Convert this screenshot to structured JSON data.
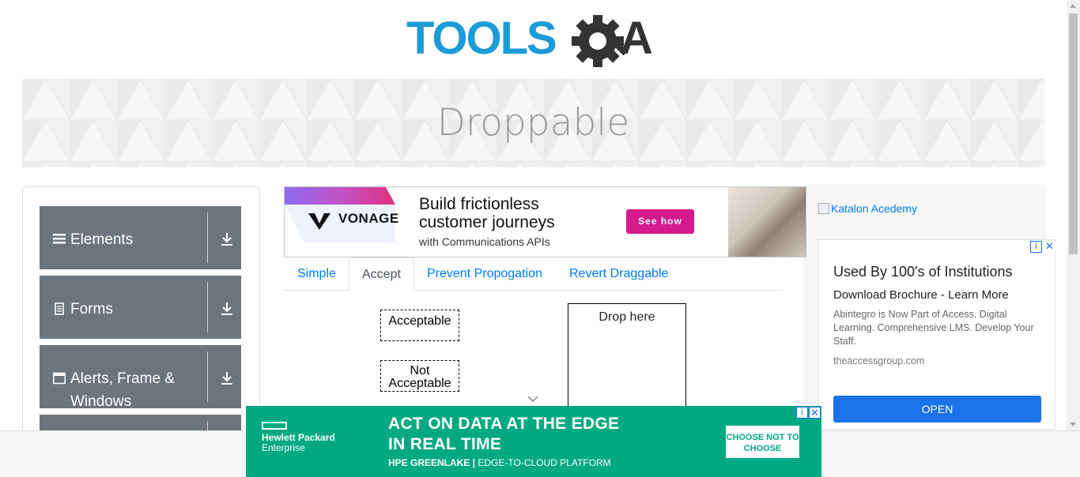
{
  "logo": {
    "text_blue": "TOOLS",
    "text_dark": "QA"
  },
  "page": {
    "title": "Droppable"
  },
  "sidebar": {
    "groups": [
      {
        "label": "Elements",
        "icon": "hamburger-icon"
      },
      {
        "label": "Forms",
        "icon": "document-icon"
      },
      {
        "label": "Alerts, Frame & Windows",
        "icon": "window-icon"
      },
      {
        "label": "",
        "icon": ""
      }
    ]
  },
  "ad_top": {
    "brand": "VONAGE",
    "headline": "Build frictionless customer journeys",
    "sub": "with Communications APIs",
    "cta": "See how"
  },
  "tabs": [
    {
      "label": "Simple",
      "active": false
    },
    {
      "label": "Accept",
      "active": true
    },
    {
      "label": "Prevent Propogation",
      "active": false
    },
    {
      "label": "Revert Draggable",
      "active": false
    }
  ],
  "accept": {
    "acceptable": "Acceptable",
    "not_acceptable": "Not Acceptable",
    "drop_here": "Drop here"
  },
  "ad_right": {
    "image_alt": "Katalon Acedemy",
    "title": "Used By 100's of Institutions",
    "subtitle": "Download Brochure - Learn More",
    "body": "Abintegro is Now Part of Access. Digital Learning. Comprehensive LMS. Develop Your Staff.",
    "url": "theaccessgroup.com",
    "cta": "OPEN"
  },
  "ad_bottom": {
    "brand_line1": "Hewlett Packard",
    "brand_line2": "Enterprise",
    "headline_line1": "ACT ON DATA AT THE EDGE",
    "headline_line2": "IN REAL TIME",
    "sub_bold": "HPE GREENLAKE |",
    "sub_rest": " EDGE-TO-CLOUD PLATFORM",
    "cta": "CHOOSE NOT TO CHOOSE"
  },
  "colors": {
    "brand_blue": "#1b9bd7",
    "brand_dark": "#333333",
    "sidebar_group": "#6c757d",
    "link": "#007bff",
    "vonage_pink": "#d6198c",
    "hpe_green": "#01a982",
    "open_button": "#1a73e8"
  }
}
